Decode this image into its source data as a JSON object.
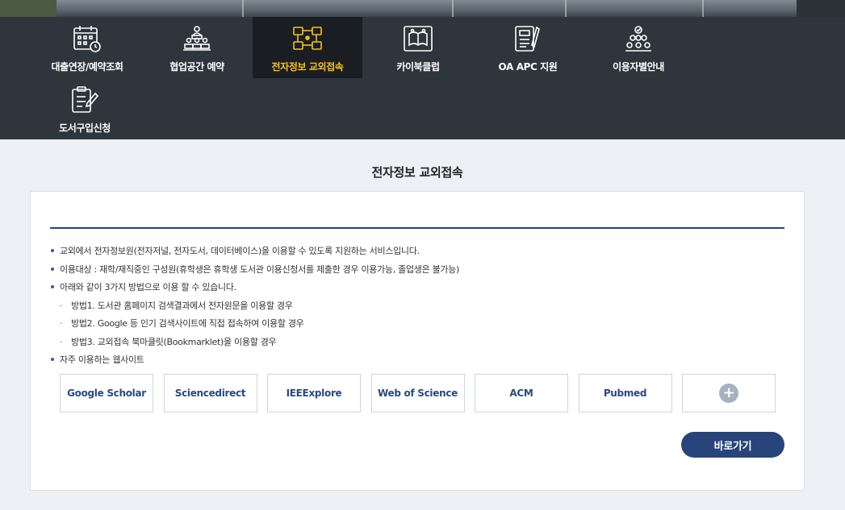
{
  "menu": {
    "items": [
      {
        "label": "대출연장/예약조회",
        "icon": "calendar-icon"
      },
      {
        "label": "협업공간 예약",
        "icon": "group-space-icon"
      },
      {
        "label": "전자정보 교외접속",
        "icon": "network-icon",
        "active": true
      },
      {
        "label": "카이북클럽",
        "icon": "book-club-icon"
      },
      {
        "label": "OA APC 지원",
        "icon": "document-pen-icon"
      },
      {
        "label": "이용자별안내",
        "icon": "user-guide-icon"
      },
      {
        "label": "도서구입신청",
        "icon": "clipboard-pen-icon"
      }
    ]
  },
  "main": {
    "title": "전자정보 교외접속",
    "bullets": [
      "교외에서 전자정보원(전자저널, 전자도서, 데이터베이스)을 이용할 수 있도록 지원하는 서비스입니다.",
      "이용대상 : 재학/재직중인 구성원(휴학생은 휴학생 도서관 이용신청서를 제출한 경우 이용가능, 졸업생은 불가능)",
      "아래와 같이 3가지 방법으로 이용 할 수 있습니다."
    ],
    "methods": [
      "방법1. 도서관 홈페이지 검색결과에서 전자원문을 이용할 경우",
      "방법2. Google 등 인기 검색사이트에 직접 접속하여 이용할 경우",
      "방법3. 교외접속 북마클릿(Bookmarklet)을 이용할 경우"
    ],
    "sites_heading": "자주 이용하는 웹사이트",
    "sites": [
      "Google Scholar",
      "Sciencedirect",
      "IEEExplore",
      "Web of Science",
      "ACM",
      "Pubmed"
    ],
    "plus_label": "+",
    "go_button": "바로가기"
  },
  "colors": {
    "menu_bg": "#2f353c",
    "active_bg": "#1a1e22",
    "active_text": "#f5c21b",
    "accent": "#27457a",
    "bullet": "#2f5aa8"
  }
}
